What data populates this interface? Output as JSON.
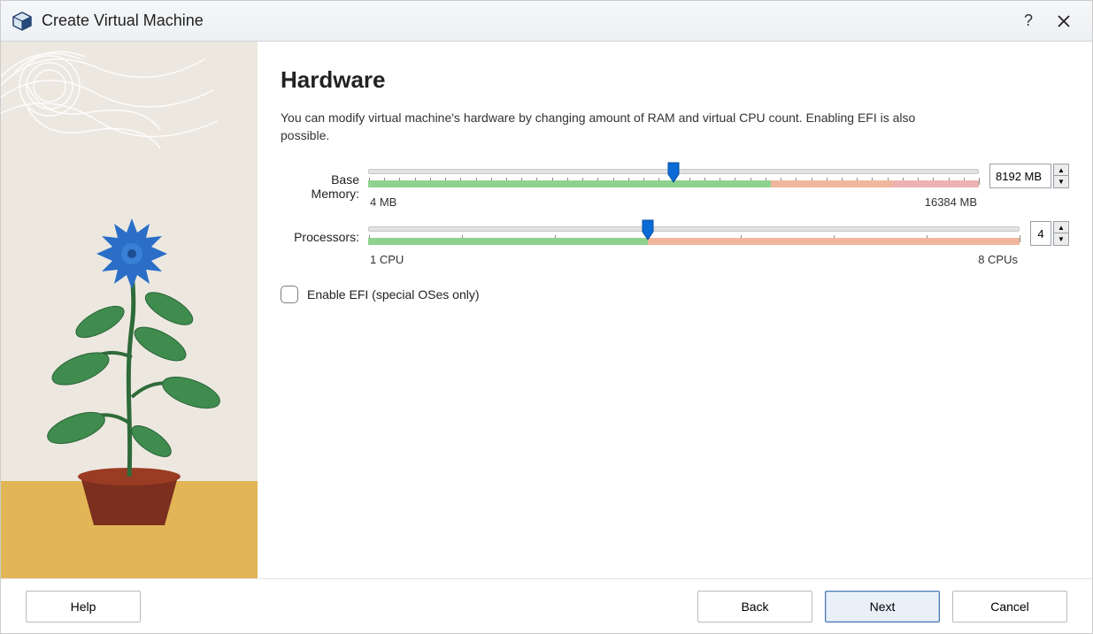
{
  "window": {
    "title": "Create Virtual Machine"
  },
  "titlebar": {
    "help": "?",
    "close": "✕"
  },
  "page": {
    "heading": "Hardware",
    "description": "You can modify virtual machine's hardware by changing amount of RAM and virtual CPU count. Enabling EFI is also possible."
  },
  "memory": {
    "label": "Base Memory:",
    "min_label": "4 MB",
    "max_label": "16384 MB",
    "value": "8192 MB",
    "thumb_percent": 50,
    "band_green": 66,
    "band_orange": 20,
    "band_pink": 14
  },
  "processors": {
    "label": "Processors:",
    "min_label": "1 CPU",
    "max_label": "8 CPUs",
    "value": "4",
    "thumb_percent": 43,
    "band_green": 43,
    "band_orange": 57
  },
  "efi": {
    "label": "Enable EFI (special OSes only)",
    "checked": false
  },
  "buttons": {
    "help": "Help",
    "back": "Back",
    "next": "Next",
    "cancel": "Cancel"
  }
}
